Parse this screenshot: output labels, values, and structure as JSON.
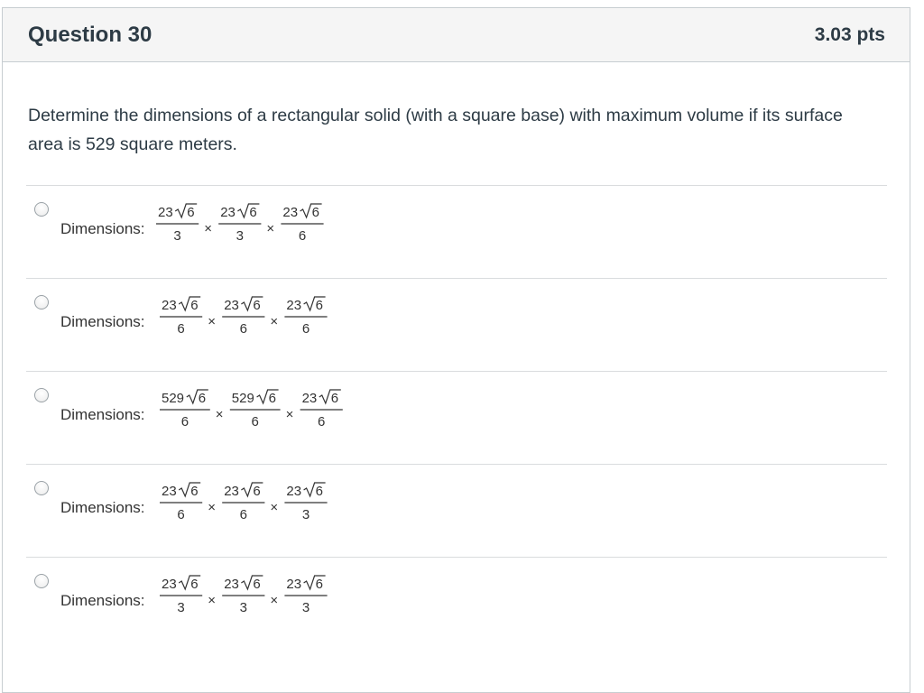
{
  "question": {
    "title": "Question 30",
    "points": "3.03 pts",
    "text": "Determine the dimensions of a rectangular solid (with a square base) with maximum volume if its surface area is 529 square meters."
  },
  "answers": [
    {
      "label": "Dimensions:",
      "times": "×",
      "radical": "6",
      "terms": [
        {
          "coef": "23",
          "den": "3"
        },
        {
          "coef": "23",
          "den": "3"
        },
        {
          "coef": "23",
          "den": "6"
        }
      ]
    },
    {
      "label": "Dimensions:",
      "times": "×",
      "radical": "6",
      "terms": [
        {
          "coef": "23",
          "den": "6"
        },
        {
          "coef": "23",
          "den": "6"
        },
        {
          "coef": "23",
          "den": "6"
        }
      ]
    },
    {
      "label": "Dimensions:",
      "times": "×",
      "radical": "6",
      "terms": [
        {
          "coef": "529",
          "den": "6"
        },
        {
          "coef": "529",
          "den": "6"
        },
        {
          "coef": "23",
          "den": "6"
        }
      ]
    },
    {
      "label": "Dimensions:",
      "times": "×",
      "radical": "6",
      "terms": [
        {
          "coef": "23",
          "den": "6"
        },
        {
          "coef": "23",
          "den": "6"
        },
        {
          "coef": "23",
          "den": "3"
        }
      ]
    },
    {
      "label": "Dimensions:",
      "times": "×",
      "radical": "6",
      "terms": [
        {
          "coef": "23",
          "den": "3"
        },
        {
          "coef": "23",
          "den": "3"
        },
        {
          "coef": "23",
          "den": "3"
        }
      ]
    }
  ]
}
